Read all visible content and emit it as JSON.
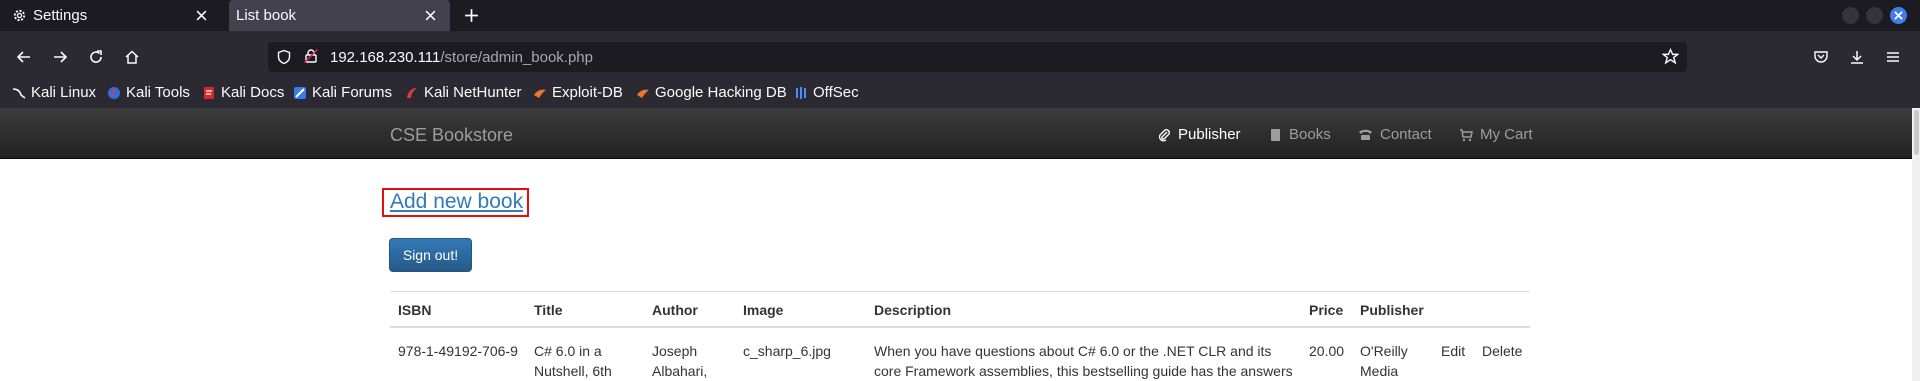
{
  "browser": {
    "tabs": [
      {
        "title": "Settings",
        "icon": "gear-icon",
        "active": false
      },
      {
        "title": "List book",
        "icon": "",
        "active": true
      }
    ],
    "url_host": "192.168.230.111",
    "url_path": "/store/admin_book.php",
    "bookmarks": [
      {
        "label": "Kali Linux",
        "icon": "kali-dragon-icon"
      },
      {
        "label": "Kali Tools",
        "icon": "kali-tools-icon"
      },
      {
        "label": "Kali Docs",
        "icon": "kali-docs-icon"
      },
      {
        "label": "Kali Forums",
        "icon": "kali-forums-icon"
      },
      {
        "label": "Kali NetHunter",
        "icon": "nethunter-icon"
      },
      {
        "label": "Exploit-DB",
        "icon": "exploit-db-icon"
      },
      {
        "label": "Google Hacking DB",
        "icon": "ghdb-icon"
      },
      {
        "label": "OffSec",
        "icon": "offsec-icon"
      }
    ]
  },
  "site": {
    "brand": "CSE Bookstore",
    "nav": [
      {
        "label": "Publisher",
        "icon": "paperclip-icon",
        "active": true
      },
      {
        "label": "Books",
        "icon": "book-icon",
        "active": false
      },
      {
        "label": "Contact",
        "icon": "phone-icon",
        "active": false
      },
      {
        "label": "My Cart",
        "icon": "cart-icon",
        "active": false
      }
    ]
  },
  "main": {
    "add_book": "Add new book",
    "sign_out": "Sign out!",
    "table": {
      "headers": [
        "ISBN",
        "Title",
        "Author",
        "Image",
        "Description",
        "Price",
        "Publisher"
      ],
      "row1": {
        "isbn": "978-1-49192-706-9",
        "title_l1": "C# 6.0 in a",
        "title_l2": "Nutshell, 6th",
        "author_l1": "Joseph",
        "author_l2": "Albahari,",
        "image": "c_sharp_6.jpg",
        "desc_l1": "When you have questions about C# 6.0 or the .NET CLR and its",
        "desc_l2": "core Framework assemblies, this bestselling guide has the answers",
        "price": "20.00",
        "publisher_l1": "O'Reilly",
        "publisher_l2": "Media",
        "edit": "Edit",
        "delete": "Delete"
      }
    }
  },
  "colors": {
    "chrome_bg": "#1c1b22",
    "toolbar_bg": "#2b2a33",
    "link": "#337ab7",
    "highlight_box": "#e01010"
  }
}
